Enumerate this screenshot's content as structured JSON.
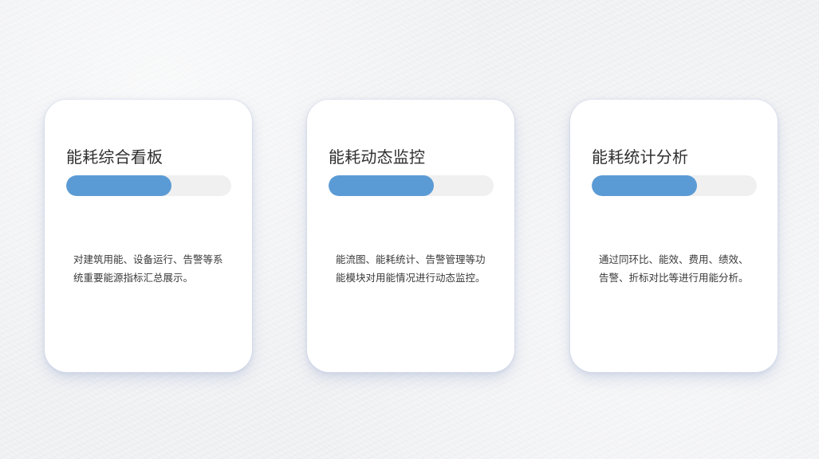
{
  "colors": {
    "accent": "#5b9bd5",
    "track": "#f0f0f0",
    "card": "#ffffff",
    "background": "#f2f3f5"
  },
  "cards": [
    {
      "title": "能耗综合看板",
      "progress": 0.64,
      "description": "对建筑用能、设备运行、告警等系统重要能源指标汇总展示。"
    },
    {
      "title": "能耗动态监控",
      "progress": 0.64,
      "description": "能流图、能耗统计、告警管理等功能模块对用能情况进行动态监控。"
    },
    {
      "title": "能耗统计分析",
      "progress": 0.64,
      "description": "通过同环比、能效、费用、绩效、告警、折标对比等进行用能分析。"
    }
  ]
}
